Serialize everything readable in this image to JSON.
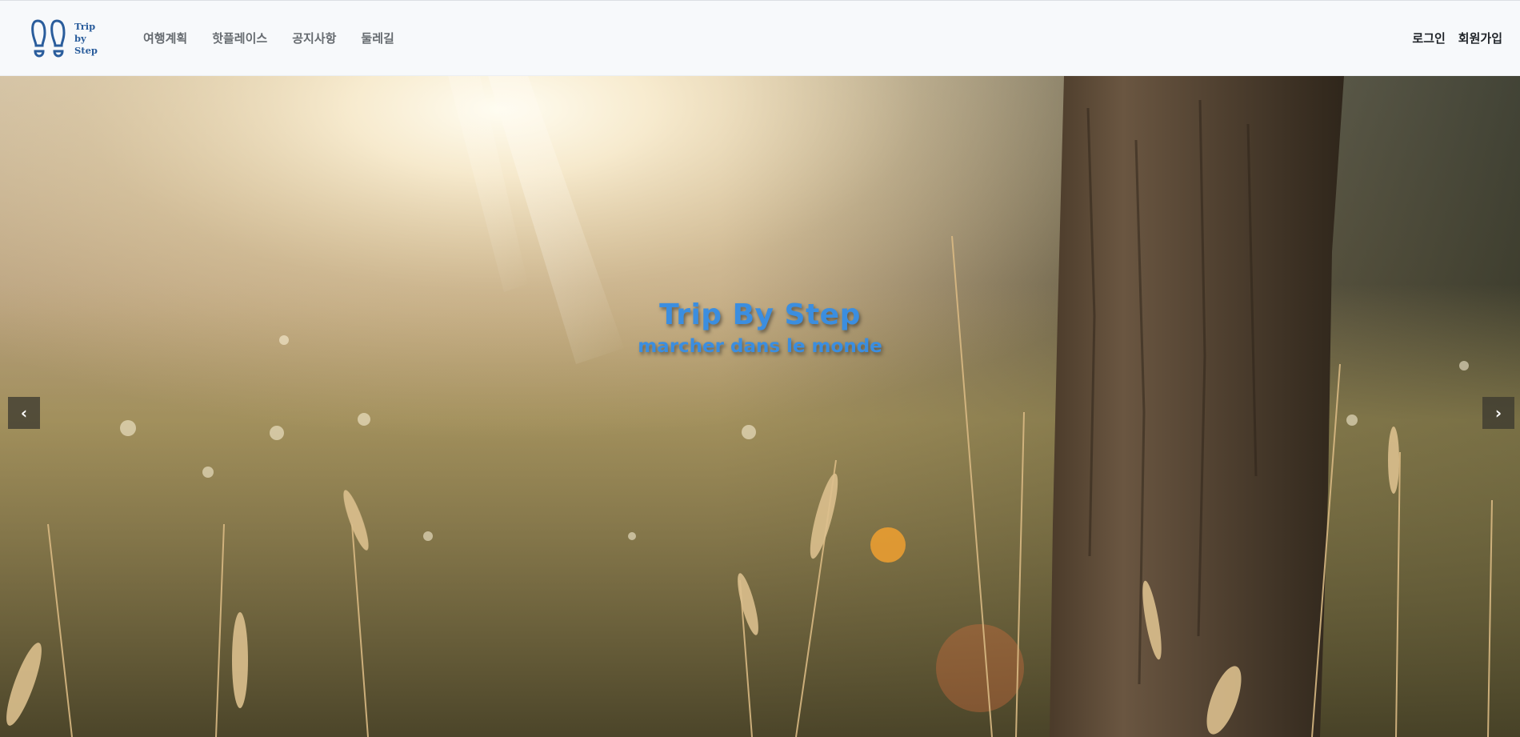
{
  "header": {
    "logo": {
      "line1": "Trip",
      "line2": "by",
      "line3": "Step",
      "icon": "footprints-icon"
    },
    "nav": [
      {
        "label": "여행계획"
      },
      {
        "label": "핫플레이스"
      },
      {
        "label": "공지사항"
      },
      {
        "label": "둘레길"
      }
    ],
    "auth": {
      "login": "로그인",
      "signup": "회원가입"
    }
  },
  "hero": {
    "title": "Trip By Step",
    "subtitle": "marcher dans le monde",
    "prev_label": "‹",
    "next_label": "›",
    "prev_icon": "chevron-left-icon",
    "next_icon": "chevron-right-icon",
    "image": "sunlit-meadow-with-tree-trunk-and-grass"
  },
  "colors": {
    "header_bg": "#f7f9fb",
    "logo": "#2a5d9c",
    "nav_text": "#666b70",
    "auth_text": "#1f2328",
    "accent": "#3b8ee0"
  }
}
